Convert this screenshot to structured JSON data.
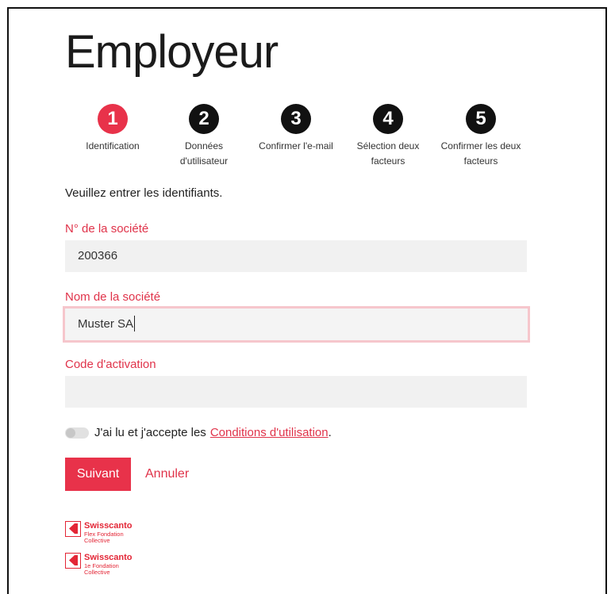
{
  "page": {
    "title": "Employeur"
  },
  "steps": [
    {
      "number": "1",
      "label_line1": "Identification",
      "label_line2": "",
      "active": true
    },
    {
      "number": "2",
      "label_line1": "Données",
      "label_line2": "d'utilisateur",
      "active": false
    },
    {
      "number": "3",
      "label_line1": "Confirmer l'e-mail",
      "label_line2": "",
      "active": false
    },
    {
      "number": "4",
      "label_line1": "Sélection deux",
      "label_line2": "facteurs",
      "active": false
    },
    {
      "number": "5",
      "label_line1": "Confirmer les deux",
      "label_line2": "facteurs",
      "active": false
    }
  ],
  "form": {
    "intro": "Veuillez entrer les identifiants.",
    "company_number": {
      "label": "N° de la société",
      "value": "200366"
    },
    "company_name": {
      "label": "Nom de la société",
      "value": "Muster SA"
    },
    "activation_code": {
      "label": "Code d'activation",
      "value": ""
    },
    "terms": {
      "text": "J'ai lu et j'accepte les",
      "link": "Conditions d'utilisation",
      "suffix": ".",
      "accepted": false
    },
    "next_label": "Suivant",
    "cancel_label": "Annuler"
  },
  "logos": [
    {
      "name": "Swisscanto",
      "sub_line1": "Flex Fondation",
      "sub_line2": "Collective"
    },
    {
      "name": "Swisscanto",
      "sub_line1": "1e Fondation",
      "sub_line2": "Collective"
    }
  ],
  "colors": {
    "accent": "#e8324a",
    "step_inactive": "#111111",
    "field_bg": "#f1f1f1"
  }
}
